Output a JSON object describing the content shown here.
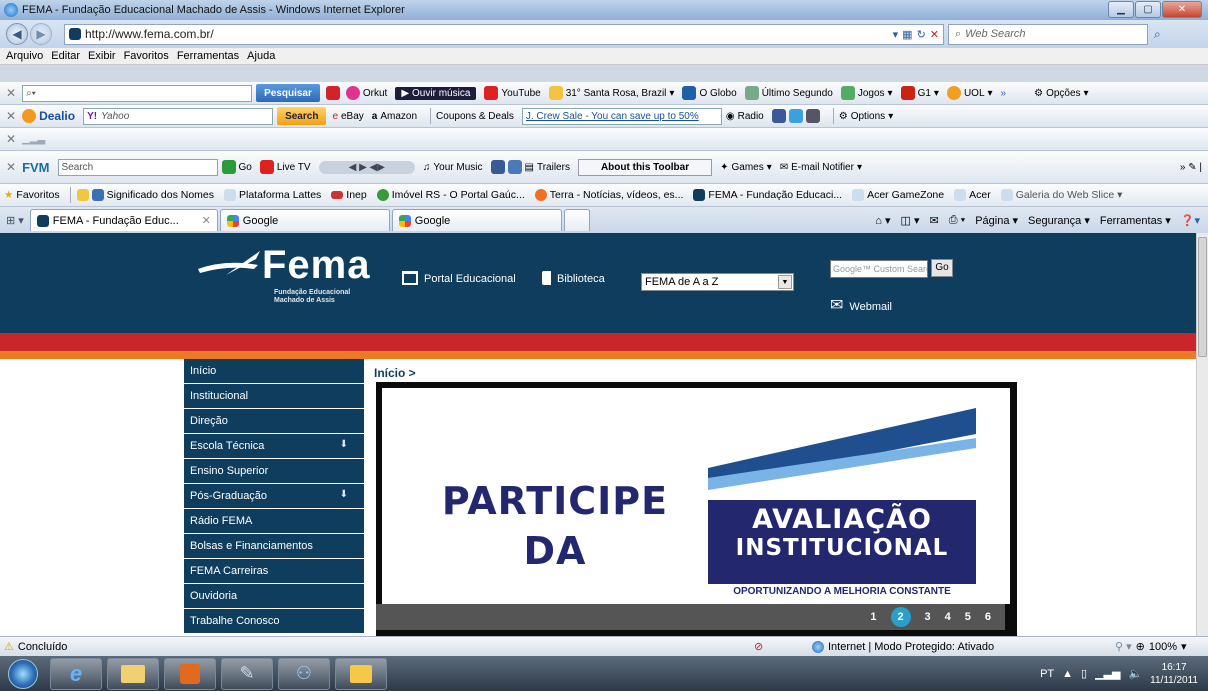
{
  "window": {
    "title": "FEMA - Fundação Educacional Machado de Assis - Windows Internet Explorer"
  },
  "address": {
    "url": "http://www.fema.com.br/",
    "search_placeholder": "Web Search"
  },
  "menu": [
    "Arquivo",
    "Editar",
    "Exibir",
    "Favoritos",
    "Ferramentas",
    "Ajuda"
  ],
  "ask_toolbar": {
    "search_button": "Pesquisar",
    "items": [
      "Orkut",
      "Ouvir música",
      "YouTube",
      "31° Santa Rosa, Brazil",
      "O Globo",
      "Último Segundo",
      "Jogos",
      "G1",
      "UOL"
    ],
    "options": "Opções"
  },
  "dealio_toolbar": {
    "brand": "Dealio",
    "search_placeholder": "Yahoo",
    "search_button": "Search",
    "items": [
      "eBay",
      "Amazon",
      "Coupons & Deals"
    ],
    "promo": "J. Crew Sale - You can save up to 50%",
    "radio": "Radio",
    "options": "Options"
  },
  "fvm_toolbar": {
    "brand": "FVM",
    "search_placeholder": "Search",
    "go": "Go",
    "items": [
      "Live TV",
      "Your Music",
      "Trailers"
    ],
    "about": "About this Toolbar",
    "games": "Games",
    "email": "E-mail Notifier"
  },
  "favorites": {
    "label": "Favoritos",
    "items": [
      "Significado dos Nomes",
      "Plataforma Lattes",
      "Inep",
      "Imóvel RS - O Portal Gaúc...",
      "Terra - Notícias, vídeos, es...",
      "FEMA - Fundação Educaci...",
      "Acer GameZone",
      "Acer",
      "Galeria do Web Slice"
    ]
  },
  "tabs": [
    "FEMA - Fundação Educ...",
    "Google",
    "Google"
  ],
  "commands": [
    "Página",
    "Segurança",
    "Ferramentas"
  ],
  "site": {
    "logo": "Fema",
    "logo_sub1": "Fundação Educacional",
    "logo_sub2": "Machado de Assis",
    "portal": "Portal Educacional",
    "biblioteca": "Biblioteca",
    "select_value": "FEMA de A a Z",
    "google_placeholder": "Google™ Custom Search",
    "go": "Go",
    "webmail": "Webmail",
    "breadcrumb": "Início >",
    "nav": [
      {
        "label": "Início",
        "sub": false
      },
      {
        "label": "Institucional",
        "sub": false
      },
      {
        "label": "Direção",
        "sub": false
      },
      {
        "label": "Escola Técnica",
        "sub": true
      },
      {
        "label": "Ensino Superior",
        "sub": false
      },
      {
        "label": "Pós-Graduação",
        "sub": true
      },
      {
        "label": "Rádio FEMA",
        "sub": false
      },
      {
        "label": "Bolsas e Financiamentos",
        "sub": false
      },
      {
        "label": "FEMA Carreiras",
        "sub": false
      },
      {
        "label": "Ouvidoria",
        "sub": false
      },
      {
        "label": "Trabalhe Conosco",
        "sub": false
      }
    ],
    "banner": {
      "line1": "PARTICIPE",
      "line2": "DA",
      "box1": "AVALIAÇÃO",
      "box2": "INSTITUCIONAL",
      "tagline": "OPORTUNIZANDO A MELHORIA CONSTANTE",
      "pages": [
        "1",
        "2",
        "3",
        "4",
        "5",
        "6"
      ],
      "active_page": "2"
    }
  },
  "status": {
    "text": "Concluído",
    "zone": "Internet | Modo Protegido: Ativado",
    "zoom": "100%"
  },
  "taskbar": {
    "lang": "PT",
    "time": "16:17",
    "date": "11/11/2011"
  },
  "colors": {
    "site_blue": "#0e3d5e",
    "red_band": "#c8262a",
    "orange_band": "#ec7a23",
    "banner_navy": "#23286e",
    "pager_active": "#28a0c8"
  }
}
